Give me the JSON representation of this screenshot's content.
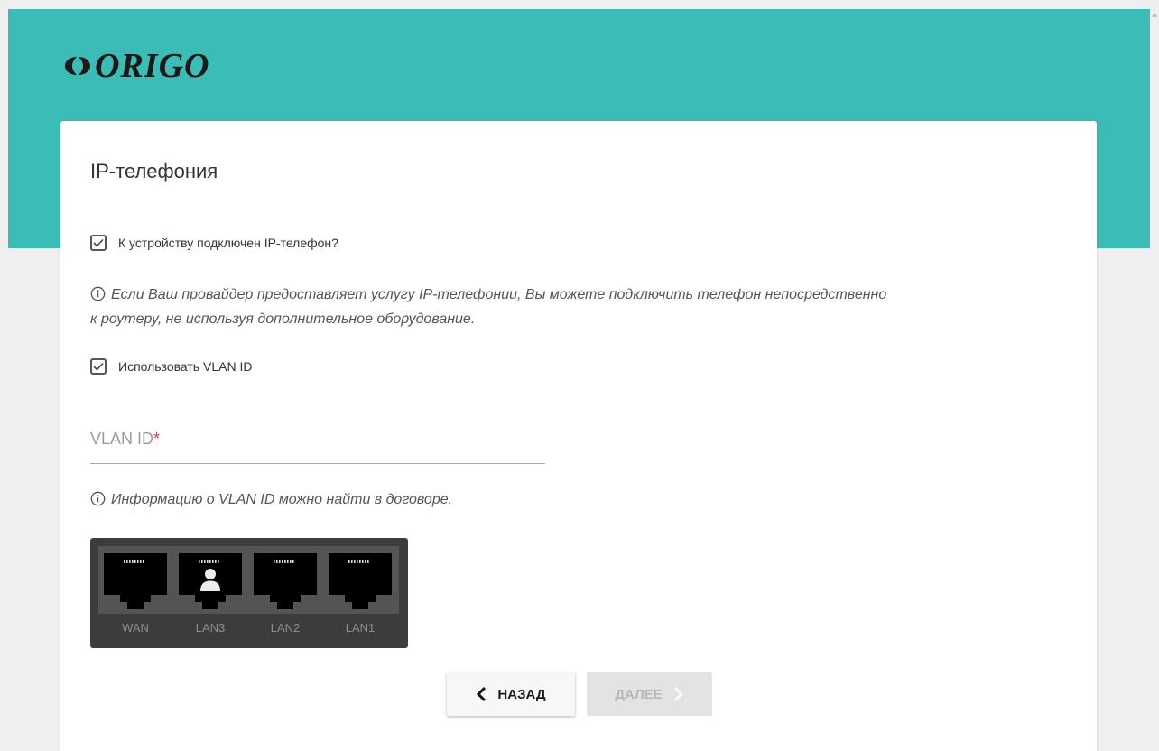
{
  "brand": {
    "name": "ORIGO",
    "accent_color": "#3bbcb6"
  },
  "page": {
    "title": "IP-телефония"
  },
  "ip_phone_checkbox": {
    "label": "К устройству подключен IP-телефон?",
    "checked": true
  },
  "info_ip_phone": {
    "line1": "Если Ваш провайдер предоставляет услугу IP-телефонии, Вы можете подключить телефон непосредственно",
    "line2": "к роутеру, не используя дополнительное оборудование."
  },
  "vlan_checkbox": {
    "label": "Использовать VLAN ID",
    "checked": true
  },
  "vlan_field": {
    "label": "VLAN ID",
    "required_mark": "*",
    "value": ""
  },
  "info_vlan": {
    "text": "Информацию о VLAN ID можно найти в договоре."
  },
  "ports": [
    {
      "label": "WAN",
      "selected": false
    },
    {
      "label": "LAN3",
      "selected": true
    },
    {
      "label": "LAN2",
      "selected": false
    },
    {
      "label": "LAN1",
      "selected": false
    }
  ],
  "buttons": {
    "back": "НАЗАД",
    "next": "ДАЛЕЕ"
  }
}
